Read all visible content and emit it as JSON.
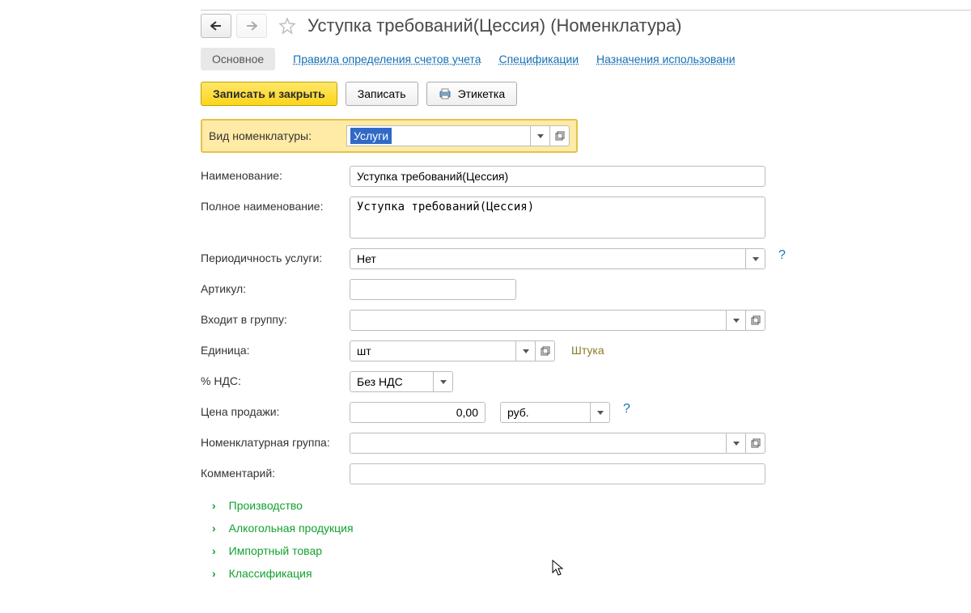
{
  "header": {
    "title": "Уступка требований(Цессия) (Номенклатура)"
  },
  "tabs": {
    "main": "Основное",
    "rules": "Правила определения счетов учета",
    "specs": "Спецификации",
    "uses": "Назначения использовани"
  },
  "toolbar": {
    "save_close": "Записать и закрыть",
    "save": "Записать",
    "label": "Этикетка"
  },
  "highlight": {
    "label": "Вид номенклатуры:",
    "value": "Услуги"
  },
  "form": {
    "name_label": "Наименование:",
    "name_value": "Уступка требований(Цессия)",
    "fullname_label": "Полное наименование:",
    "fullname_value": "Уступка требований(Цессия)",
    "period_label": "Периодичность услуги:",
    "period_value": "Нет",
    "sku_label": "Артикул:",
    "sku_value": "",
    "group_label": "Входит в группу:",
    "group_value": "",
    "unit_label": "Единица:",
    "unit_value": "шт",
    "unit_hint": "Штука",
    "vat_label": "% НДС:",
    "vat_value": "Без НДС",
    "price_label": "Цена продажи:",
    "price_value": "0,00",
    "currency_value": "руб.",
    "nomgroup_label": "Номенклатурная группа:",
    "nomgroup_value": "",
    "comment_label": "Комментарий:",
    "comment_value": ""
  },
  "sections": {
    "s1": "Производство",
    "s2": "Алкогольная продукция",
    "s3": "Импортный товар",
    "s4": "Классификация"
  },
  "help_char": "?"
}
